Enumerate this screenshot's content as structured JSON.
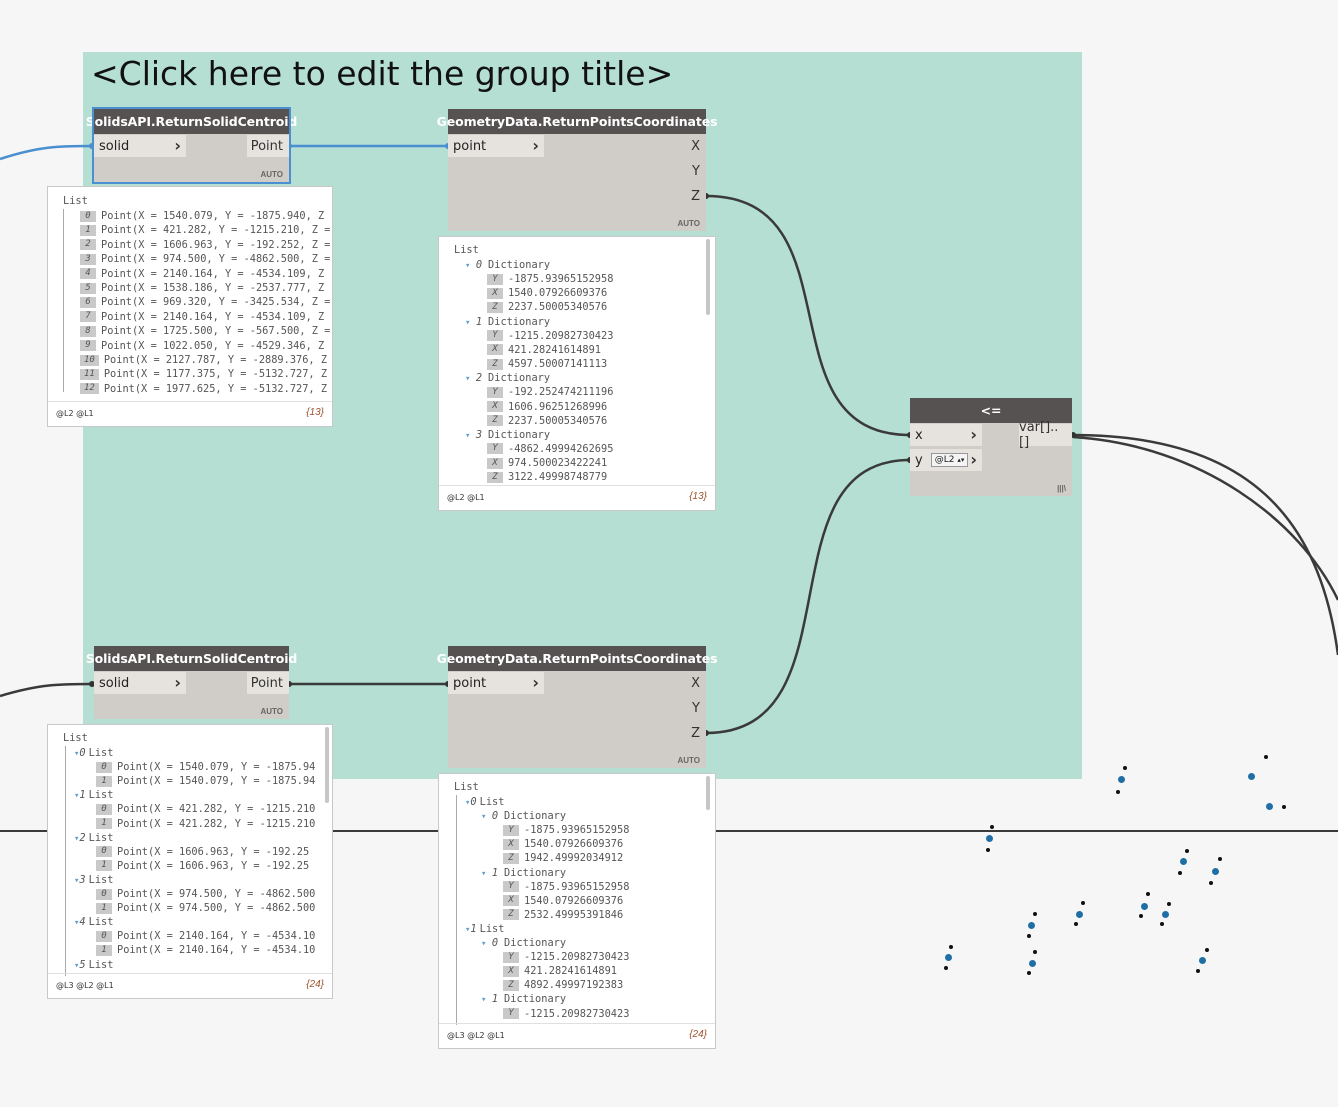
{
  "group": {
    "title": "<Click here to edit the group title>"
  },
  "nodes": {
    "centroid1": {
      "title": "SolidsAPI.ReturnSolidCentroid",
      "input": "solid",
      "output": "Point",
      "lacing": "AUTO"
    },
    "coords1": {
      "title": "GeometryData.ReturnPointsCoordinates",
      "input": "point",
      "outputs": [
        "X",
        "Y",
        "Z"
      ],
      "lacing": "AUTO"
    },
    "centroid2": {
      "title": "SolidsAPI.ReturnSolidCentroid",
      "input": "solid",
      "output": "Point",
      "lacing": "AUTO"
    },
    "coords2": {
      "title": "GeometryData.ReturnPointsCoordinates",
      "input": "point",
      "outputs": [
        "X",
        "Y",
        "Z"
      ],
      "lacing": "AUTO"
    },
    "compare": {
      "title": "<=",
      "input_x": "x",
      "input_y": "y",
      "y_value": "@L2",
      "output": "var[]..[]",
      "lacing": "|||\\"
    }
  },
  "preview1": {
    "header": "List",
    "rows": [
      {
        "i": "0",
        "t": "Point(X = 1540.079, Y = -1875.940, Z"
      },
      {
        "i": "1",
        "t": "Point(X = 421.282, Y = -1215.210, Z ="
      },
      {
        "i": "2",
        "t": "Point(X = 1606.963, Y = -192.252, Z ="
      },
      {
        "i": "3",
        "t": "Point(X = 974.500, Y = -4862.500, Z ="
      },
      {
        "i": "4",
        "t": "Point(X = 2140.164, Y = -4534.109, Z"
      },
      {
        "i": "5",
        "t": "Point(X = 1538.186, Y = -2537.777, Z"
      },
      {
        "i": "6",
        "t": "Point(X = 969.320, Y = -3425.534, Z ="
      },
      {
        "i": "7",
        "t": "Point(X = 2140.164, Y = -4534.109, Z"
      },
      {
        "i": "8",
        "t": "Point(X = 1725.500, Y = -567.500, Z ="
      },
      {
        "i": "9",
        "t": "Point(X = 1022.050, Y = -4529.346, Z"
      },
      {
        "i": "10",
        "t": "Point(X = 2127.787, Y = -2889.376, Z"
      },
      {
        "i": "11",
        "t": "Point(X = 1177.375, Y = -5132.727, Z"
      },
      {
        "i": "12",
        "t": "Point(X = 1977.625, Y = -5132.727, Z"
      }
    ],
    "levels": "@L2 @L1",
    "count": "{13}"
  },
  "preview2": {
    "header": "List",
    "rows": [
      {
        "kind": "dict",
        "i": "0",
        "t": "Dictionary"
      },
      {
        "kind": "kv",
        "k": "Y",
        "v": "-1875.93965152958"
      },
      {
        "kind": "kv",
        "k": "X",
        "v": "1540.07926609376"
      },
      {
        "kind": "kv",
        "k": "Z",
        "v": "2237.50005340576"
      },
      {
        "kind": "dict",
        "i": "1",
        "t": "Dictionary"
      },
      {
        "kind": "kv",
        "k": "Y",
        "v": "-1215.20982730423"
      },
      {
        "kind": "kv",
        "k": "X",
        "v": "421.28241614891"
      },
      {
        "kind": "kv",
        "k": "Z",
        "v": "4597.50007141113"
      },
      {
        "kind": "dict",
        "i": "2",
        "t": "Dictionary"
      },
      {
        "kind": "kv",
        "k": "Y",
        "v": "-192.252474211196"
      },
      {
        "kind": "kv",
        "k": "X",
        "v": "1606.96251268996"
      },
      {
        "kind": "kv",
        "k": "Z",
        "v": "2237.50005340576"
      },
      {
        "kind": "dict",
        "i": "3",
        "t": "Dictionary"
      },
      {
        "kind": "kv",
        "k": "Y",
        "v": "-4862.49994262695"
      },
      {
        "kind": "kv",
        "k": "X",
        "v": "974.500023422241"
      },
      {
        "kind": "kv",
        "k": "Z",
        "v": "3122.49998748779"
      }
    ],
    "levels": "@L2 @L1",
    "count": "{13}"
  },
  "preview3": {
    "header": "List",
    "rows": [
      {
        "kind": "list",
        "i": "0",
        "t": "List"
      },
      {
        "kind": "item",
        "i": "0",
        "t": "Point(X = 1540.079, Y = -1875.94"
      },
      {
        "kind": "item",
        "i": "1",
        "t": "Point(X = 1540.079, Y = -1875.94"
      },
      {
        "kind": "list",
        "i": "1",
        "t": "List"
      },
      {
        "kind": "item",
        "i": "0",
        "t": "Point(X = 421.282, Y = -1215.210"
      },
      {
        "kind": "item",
        "i": "1",
        "t": "Point(X = 421.282, Y = -1215.210"
      },
      {
        "kind": "list",
        "i": "2",
        "t": "List"
      },
      {
        "kind": "item",
        "i": "0",
        "t": "Point(X = 1606.963, Y = -192.25"
      },
      {
        "kind": "item",
        "i": "1",
        "t": "Point(X = 1606.963, Y = -192.25"
      },
      {
        "kind": "list",
        "i": "3",
        "t": "List"
      },
      {
        "kind": "item",
        "i": "0",
        "t": "Point(X = 974.500, Y = -4862.500"
      },
      {
        "kind": "item",
        "i": "1",
        "t": "Point(X = 974.500, Y = -4862.500"
      },
      {
        "kind": "list",
        "i": "4",
        "t": "List"
      },
      {
        "kind": "item",
        "i": "0",
        "t": "Point(X = 2140.164, Y = -4534.10"
      },
      {
        "kind": "item",
        "i": "1",
        "t": "Point(X = 2140.164, Y = -4534.10"
      },
      {
        "kind": "list",
        "i": "5",
        "t": "List"
      }
    ],
    "levels": "@L3 @L2 @L1",
    "count": "{24}"
  },
  "preview4": {
    "header": "List",
    "rows": [
      {
        "kind": "list",
        "i": "0",
        "t": "List",
        "d": 0
      },
      {
        "kind": "dict",
        "i": "0",
        "t": "Dictionary",
        "d": 1
      },
      {
        "kind": "kv",
        "k": "Y",
        "v": "-1875.93965152958",
        "d": 1
      },
      {
        "kind": "kv",
        "k": "X",
        "v": "1540.07926609376",
        "d": 1
      },
      {
        "kind": "kv",
        "k": "Z",
        "v": "1942.49992034912",
        "d": 1
      },
      {
        "kind": "dict",
        "i": "1",
        "t": "Dictionary",
        "d": 1
      },
      {
        "kind": "kv",
        "k": "Y",
        "v": "-1875.93965152958",
        "d": 1
      },
      {
        "kind": "kv",
        "k": "X",
        "v": "1540.07926609376",
        "d": 1
      },
      {
        "kind": "kv",
        "k": "Z",
        "v": "2532.49995391846",
        "d": 1
      },
      {
        "kind": "list",
        "i": "1",
        "t": "List",
        "d": 0
      },
      {
        "kind": "dict",
        "i": "0",
        "t": "Dictionary",
        "d": 1
      },
      {
        "kind": "kv",
        "k": "Y",
        "v": "-1215.20982730423",
        "d": 1
      },
      {
        "kind": "kv",
        "k": "X",
        "v": "421.28241614891",
        "d": 1
      },
      {
        "kind": "kv",
        "k": "Z",
        "v": "4892.49997192383",
        "d": 1
      },
      {
        "kind": "dict",
        "i": "1",
        "t": "Dictionary",
        "d": 1
      },
      {
        "kind": "kv",
        "k": "Y",
        "v": "-1215.20982730423",
        "d": 1
      }
    ],
    "levels": "@L3 @L2 @L1",
    "count": "{24}"
  },
  "colors": {
    "group_bg": "#b4dfd2",
    "node_header": "#565252",
    "node_body": "#d0ccc7",
    "selected_wire": "#4a90d0",
    "wire": "#3a3a3a",
    "point_marker": "#1f6fa6"
  }
}
